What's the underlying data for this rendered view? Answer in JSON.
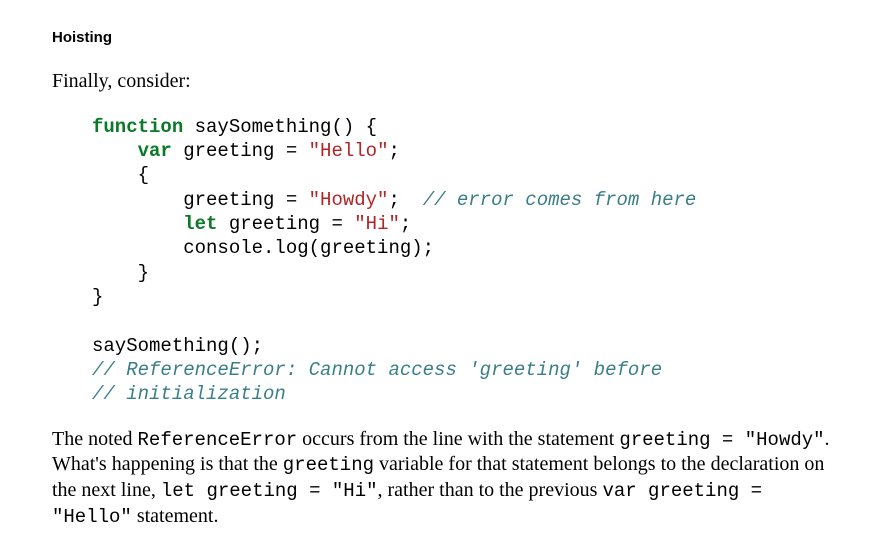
{
  "heading": "Hoisting",
  "intro": "Finally, consider:",
  "code": {
    "l1": {
      "kw": "function",
      "rest": " saySomething() {"
    },
    "l2": {
      "kw": "var",
      "mid": " greeting = ",
      "str": "\"Hello\"",
      "end": ";"
    },
    "l3": "{",
    "l4": {
      "a": "greeting = ",
      "str": "\"Howdy\"",
      "b": ";  ",
      "cmt": "// error comes from here"
    },
    "l5": {
      "kw": "let",
      "mid": " greeting = ",
      "str": "\"Hi\"",
      "end": ";"
    },
    "l6": "console.log(greeting);",
    "l7": "}",
    "l8": "}",
    "gap": "",
    "l9": "saySomething();",
    "l10": "// ReferenceError: Cannot access 'greeting' before",
    "l11": "// initialization"
  },
  "para": {
    "t1": "The noted ",
    "m1": "ReferenceError",
    "t2": " occurs from the line with the statement ",
    "m2": "greeting = \"Howdy\"",
    "t3": ". What's happening is that the ",
    "m3": "greeting",
    "t4": " variable for that statement belongs to the declaration on the next line, ",
    "m4": "let greeting = \"Hi\"",
    "t5": ", rather than to the previous ",
    "m5": "var greeting = \"Hello\"",
    "t6": " statement."
  }
}
